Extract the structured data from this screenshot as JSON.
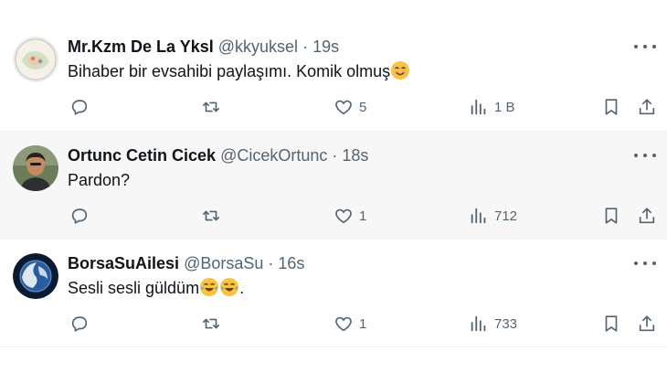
{
  "tweets": [
    {
      "display_name": "Mr.Kzm De La Yksl",
      "handle": "@kkyuksel",
      "dot": "·",
      "time": "19s",
      "text": "Bihaber bir evsahibi paylaşımı. Komik olmuş",
      "emoji": [
        "smiling-face-with-smiling-eyes"
      ],
      "likes": "5",
      "views": "1 B"
    },
    {
      "display_name": "Ortunc Cetin Cicek",
      "handle": "@CicekOrtunc",
      "dot": "·",
      "time": "18s",
      "text": "Pardon?",
      "emoji": [],
      "likes": "1",
      "views": "712"
    },
    {
      "display_name": "BorsaSuAilesi",
      "handle": "@BorsaSu",
      "dot": "·",
      "time": "16s",
      "text": "Sesli sesli güldüm",
      "text_suffix": ".",
      "emoji": [
        "face-with-tears-of-joy",
        "face-with-tears-of-joy"
      ],
      "likes": "1",
      "views": "733"
    }
  ],
  "colors": {
    "text": "#0f1419",
    "secondary": "#536471",
    "hover_bg": "#f7f7f7",
    "divider": "#eff3f4"
  },
  "icons": [
    "reply-icon",
    "retweet-icon",
    "like-icon",
    "views-icon",
    "bookmark-icon",
    "share-icon",
    "more-icon"
  ]
}
